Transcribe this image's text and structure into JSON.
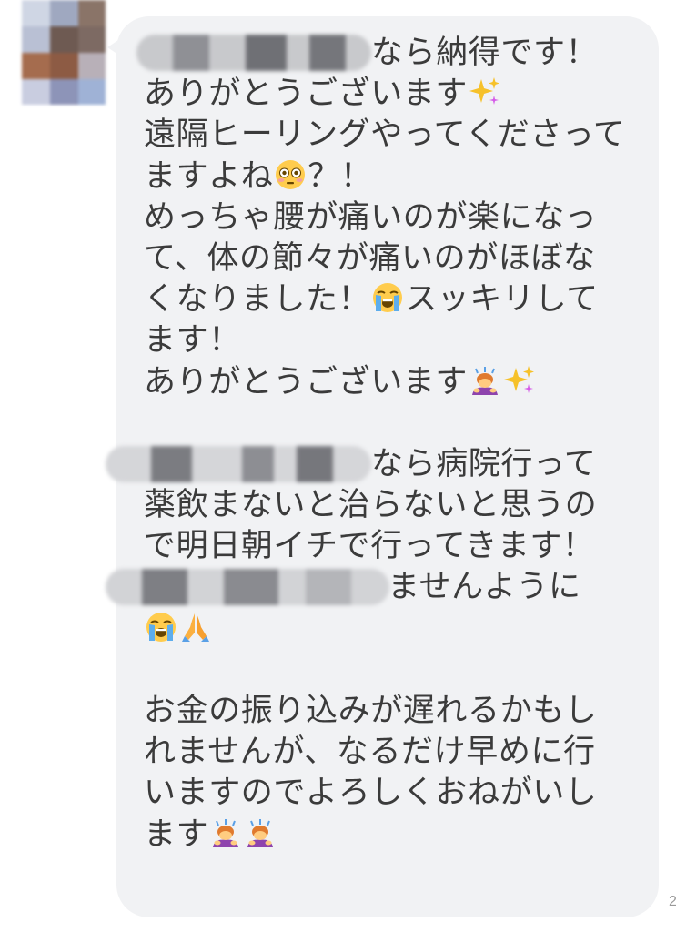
{
  "chat": {
    "avatar_icon": "blurred-profile-photo",
    "bubble_color": "#f1f2f4",
    "text_color": "#3b3b3b",
    "timestamp_fragment": "2",
    "message": {
      "l1": "なら納得です！",
      "l2": "ありがとうございます",
      "l3": "遠隔ヒーリングやってくださって",
      "l4": "ますよね",
      "l4b": "？！",
      "l5": "めっちゃ腰が痛いのが楽になっ",
      "l6": "て、体の節々が痛いのがほぼな",
      "l7": "くなりました！",
      "l7b": "スッキリして",
      "l8": "ます！",
      "l9": "ありがとうございます",
      "l10": "なら病院行って",
      "l11": "薬飲まないと治らないと思うの",
      "l12": "で明日朝イチで行ってきます！",
      "l13": "ませんように",
      "l14": "お金の振り込みが遅れるかもし",
      "l15": "れませんが、なるだけ早めに行",
      "l16": "いますのでよろしくおねがいし",
      "l17": "ます"
    },
    "emojis": {
      "sparkles": "sparkles-icon",
      "flushed": "flushed-face-icon",
      "crying": "loudly-crying-face-icon",
      "bowing": "person-bowing-icon",
      "praying": "folded-hands-icon"
    }
  }
}
